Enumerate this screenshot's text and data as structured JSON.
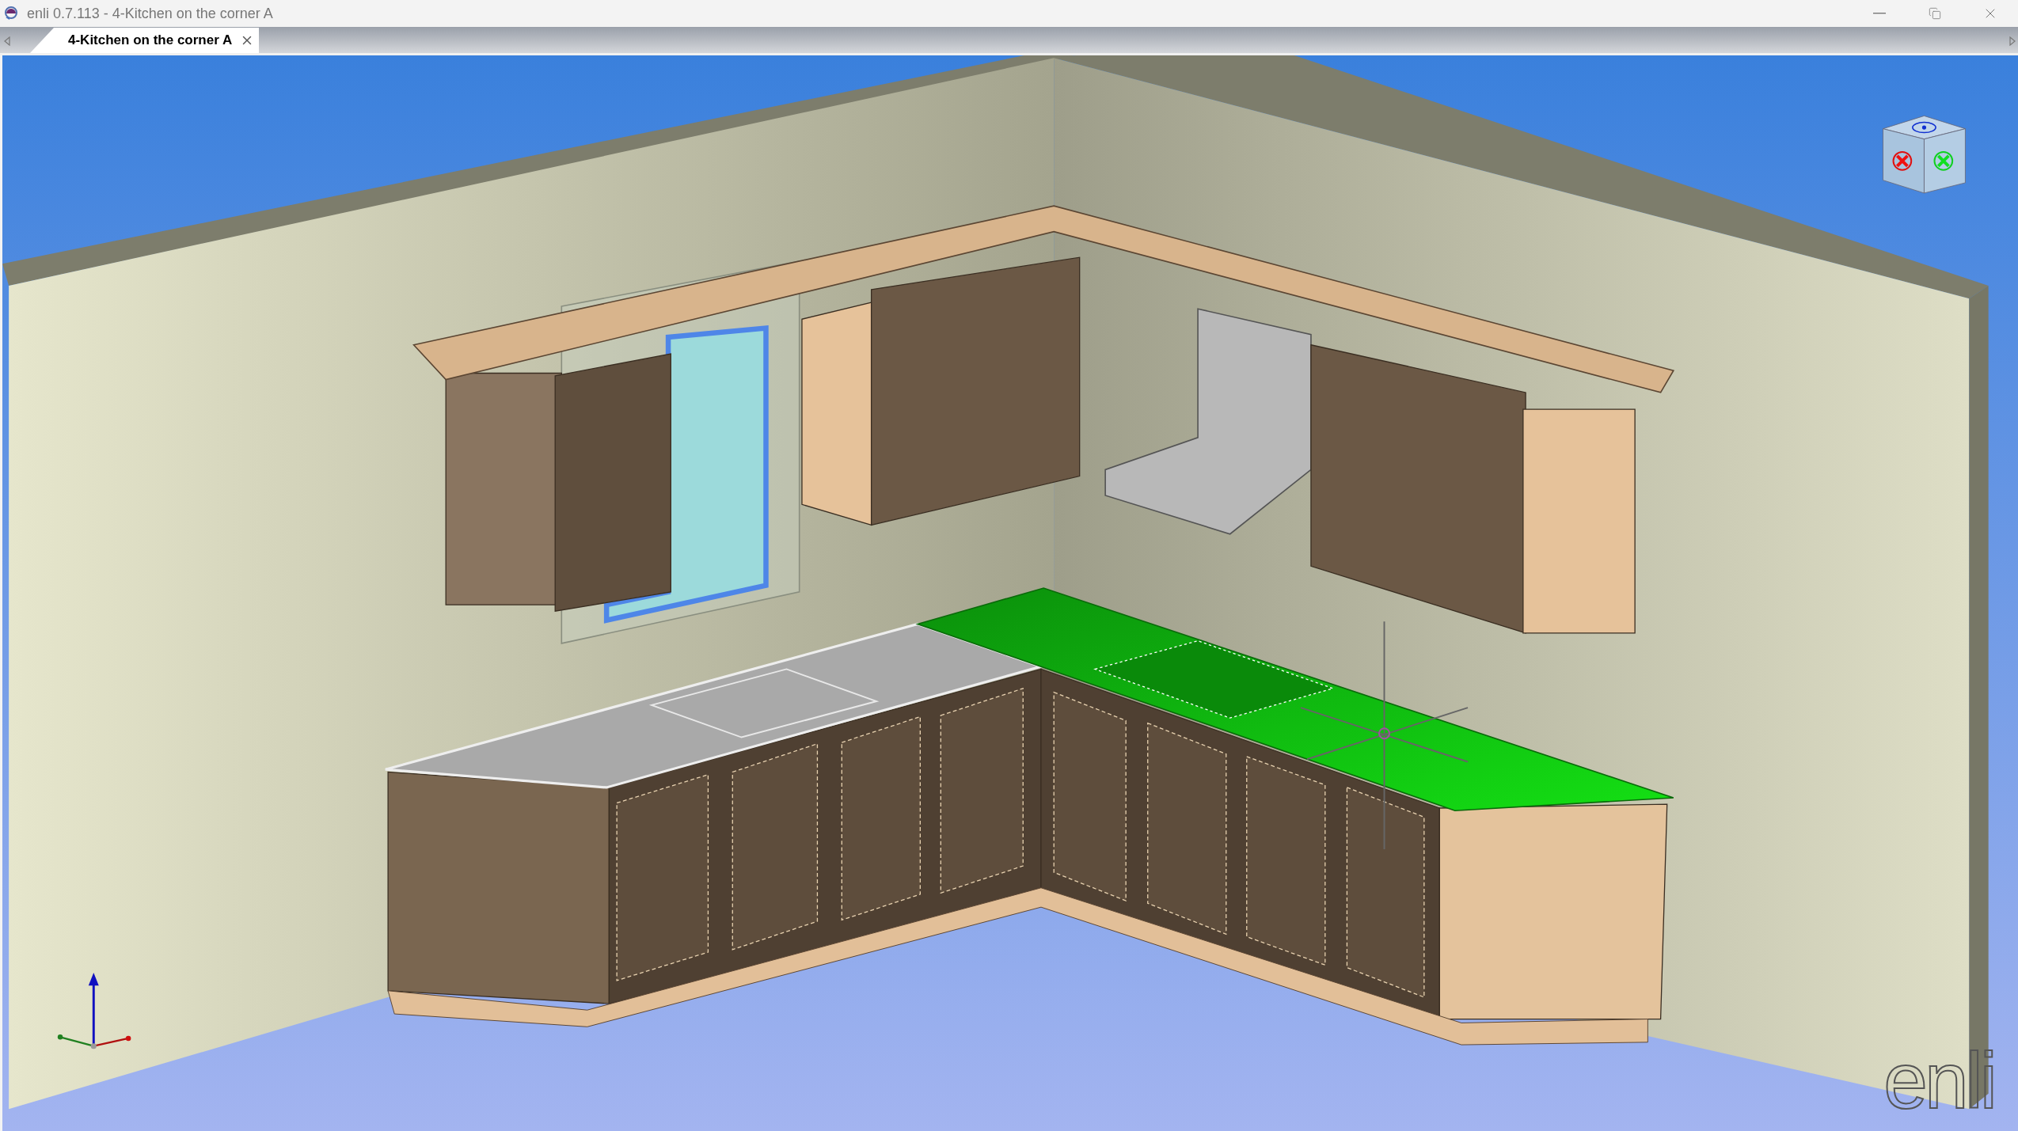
{
  "window": {
    "title": "enli 0.7.113 - 4-Kitchen on the corner A"
  },
  "tabs": [
    {
      "label": "4-Kitchen on the corner A",
      "selected": true
    }
  ],
  "viewport": {
    "logo_text": "enli"
  }
}
